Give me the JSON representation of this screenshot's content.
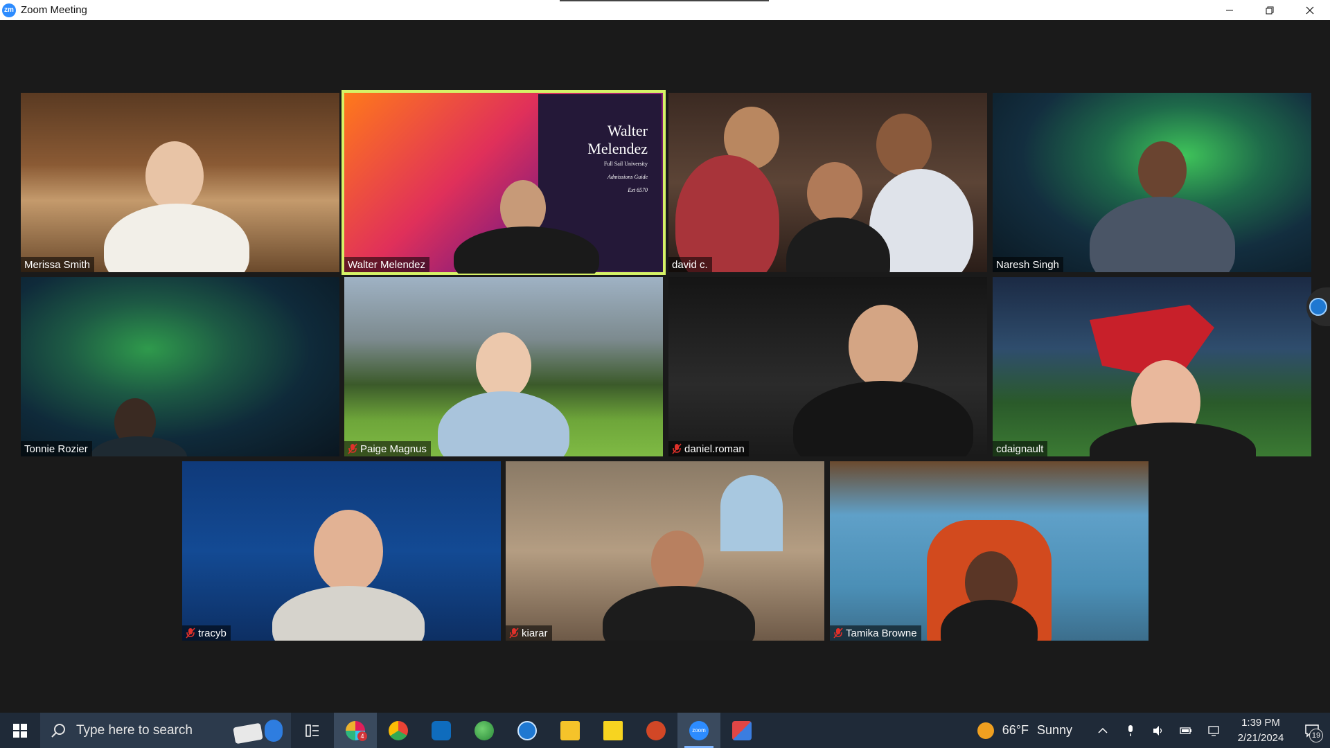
{
  "window": {
    "app_logo": "zm",
    "title": "Zoom Meeting",
    "controls": [
      "minimize-icon",
      "restore-icon",
      "close-icon"
    ]
  },
  "participants": [
    {
      "name": "Merissa Smith",
      "muted": false,
      "active_speaker": false,
      "background": "library"
    },
    {
      "name": "Walter Melendez",
      "muted": false,
      "active_speaker": true,
      "background": "slide"
    },
    {
      "name": "david c.",
      "muted": false,
      "active_speaker": false,
      "background": "room"
    },
    {
      "name": "Naresh Singh",
      "muted": false,
      "active_speaker": false,
      "background": "aurora"
    },
    {
      "name": "Tonnie Rozier",
      "muted": false,
      "active_speaker": false,
      "background": "aurora"
    },
    {
      "name": "Paige Magnus",
      "muted": true,
      "active_speaker": false,
      "background": "yosemite"
    },
    {
      "name": "daniel.roman",
      "muted": true,
      "active_speaker": false,
      "background": "dark"
    },
    {
      "name": "cdaignault",
      "muted": false,
      "active_speaker": false,
      "background": "stadium"
    },
    {
      "name": "tracyb",
      "muted": true,
      "active_speaker": false,
      "background": "blue"
    },
    {
      "name": "kiarar",
      "muted": true,
      "active_speaker": false,
      "background": "office"
    },
    {
      "name": "Tamika Browne",
      "muted": true,
      "active_speaker": false,
      "background": "sponge"
    }
  ],
  "slide": {
    "title_line1": "Walter",
    "title_line2": "Melendez",
    "org": "Full Sail University",
    "role": "Admissions Guide",
    "ext": "Ext 6570"
  },
  "taskbar": {
    "search_placeholder": "Type here to search",
    "apps": [
      {
        "icon": "task-view-icon"
      },
      {
        "icon": "slack-icon",
        "badge": "4"
      },
      {
        "icon": "chrome-icon"
      },
      {
        "icon": "outlook-icon"
      },
      {
        "icon": "globe-icon"
      },
      {
        "icon": "companion-icon"
      },
      {
        "icon": "file-explorer-icon"
      },
      {
        "icon": "sticky-notes-icon"
      },
      {
        "icon": "powerpoint-icon"
      },
      {
        "icon": "zoom-icon",
        "label": "zoom"
      },
      {
        "icon": "snipping-tool-icon"
      }
    ],
    "weather": {
      "temp": "66°F",
      "condition": "Sunny"
    },
    "clock": {
      "time": "1:39 PM",
      "date": "2/21/2024"
    },
    "notifications": "19"
  },
  "colors": {
    "active_speaker_border": "#d6f267",
    "meeting_bg": "#1a1a1a",
    "taskbar_bg": "#1f2a38",
    "mute_icon": "#e0302a"
  }
}
